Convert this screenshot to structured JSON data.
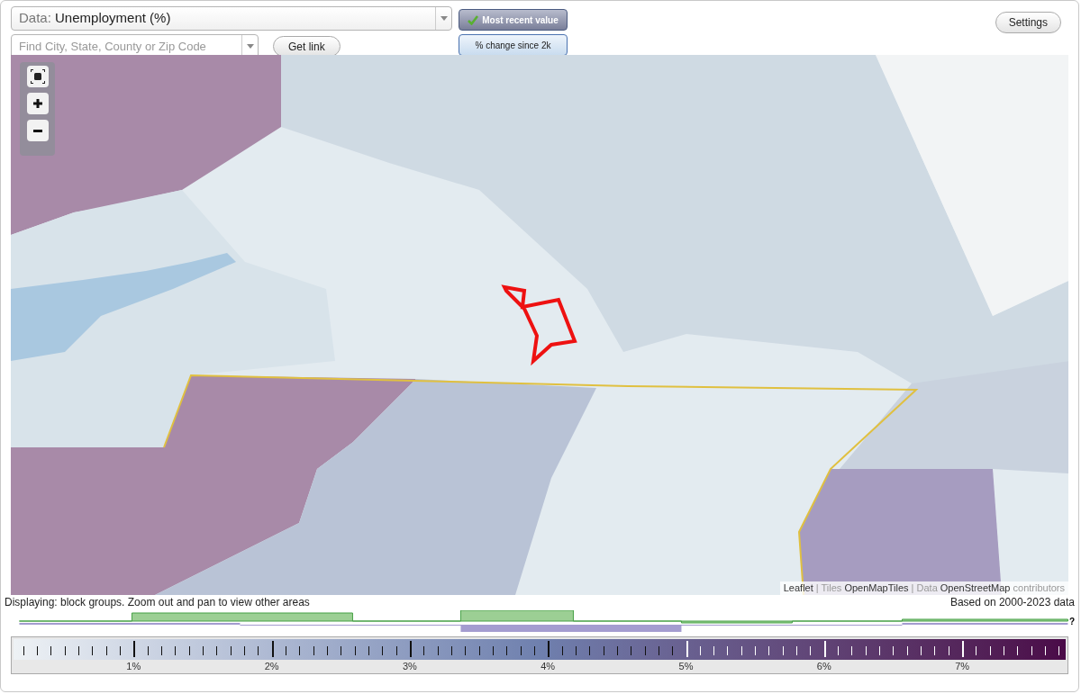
{
  "data_select": {
    "label": "Data:",
    "value": "Unemployment (%)"
  },
  "search": {
    "placeholder": "Find City, State, County or Zip Code"
  },
  "get_link": "Get link",
  "mode_buttons": [
    {
      "label": "Most recent value",
      "selected": true
    },
    {
      "label": "% change since 2k",
      "selected": false
    }
  ],
  "settings": "Settings",
  "map": {
    "attribution": [
      {
        "text": "Leaflet",
        "kind": "link"
      },
      {
        "text": " | Tiles ",
        "kind": "plain"
      },
      {
        "text": "OpenMapTiles",
        "kind": "link"
      },
      {
        "text": " | Data ",
        "kind": "plain"
      },
      {
        "text": "OpenStreetMap",
        "kind": "link"
      },
      {
        "text": " contributors",
        "kind": "plain"
      }
    ]
  },
  "caption": "Displaying: block groups. Zoom out and pan to view other areas",
  "based_on": "Based on 2000-2023 data",
  "histogram": {
    "help": "?"
  },
  "legend": {
    "labels": [
      "1%",
      "2%",
      "3%",
      "4%",
      "5%",
      "6%",
      "7%"
    ]
  }
}
